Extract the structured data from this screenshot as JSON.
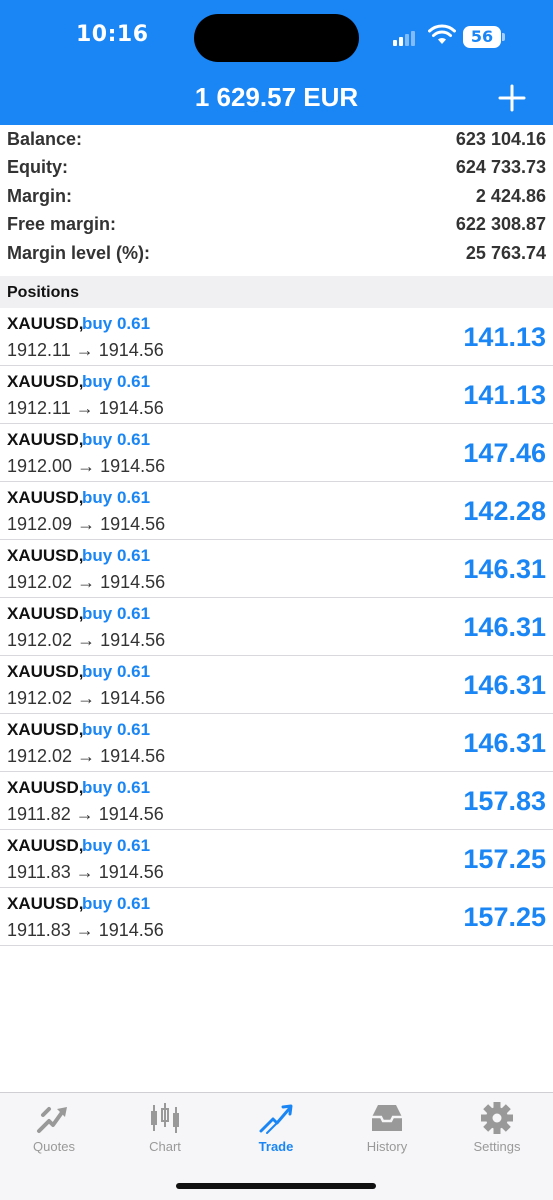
{
  "status_bar": {
    "time": "10:16",
    "battery": "56"
  },
  "header": {
    "title": "1 629.57 EUR"
  },
  "account": [
    {
      "label": "Balance:",
      "value": "623 104.16"
    },
    {
      "label": "Equity:",
      "value": "624 733.73"
    },
    {
      "label": "Margin:",
      "value": "2 424.86"
    },
    {
      "label": "Free margin:",
      "value": "622 308.87"
    },
    {
      "label": "Margin level (%):",
      "value": "25 763.74"
    }
  ],
  "positions_title": "Positions",
  "positions": [
    {
      "symbol": "XAUUSD,",
      "type": "buy 0.61",
      "prices": "1912.11 → 1914.56",
      "profit": "141.13"
    },
    {
      "symbol": "XAUUSD,",
      "type": "buy 0.61",
      "prices": "1912.11 → 1914.56",
      "profit": "141.13"
    },
    {
      "symbol": "XAUUSD,",
      "type": "buy 0.61",
      "prices": "1912.00 → 1914.56",
      "profit": "147.46"
    },
    {
      "symbol": "XAUUSD,",
      "type": "buy 0.61",
      "prices": "1912.09 → 1914.56",
      "profit": "142.28"
    },
    {
      "symbol": "XAUUSD,",
      "type": "buy 0.61",
      "prices": "1912.02 → 1914.56",
      "profit": "146.31"
    },
    {
      "symbol": "XAUUSD,",
      "type": "buy 0.61",
      "prices": "1912.02 → 1914.56",
      "profit": "146.31"
    },
    {
      "symbol": "XAUUSD,",
      "type": "buy 0.61",
      "prices": "1912.02 → 1914.56",
      "profit": "146.31"
    },
    {
      "symbol": "XAUUSD,",
      "type": "buy 0.61",
      "prices": "1912.02 → 1914.56",
      "profit": "146.31"
    },
    {
      "symbol": "XAUUSD,",
      "type": "buy 0.61",
      "prices": "1911.82 → 1914.56",
      "profit": "157.83"
    },
    {
      "symbol": "XAUUSD,",
      "type": "buy 0.61",
      "prices": "1911.83 → 1914.56",
      "profit": "157.25"
    },
    {
      "symbol": "XAUUSD,",
      "type": "buy 0.61",
      "prices": "1911.83 → 1914.56",
      "profit": "157.25"
    }
  ],
  "tabs": [
    {
      "label": "Quotes",
      "icon": "quotes-icon"
    },
    {
      "label": "Chart",
      "icon": "chart-icon"
    },
    {
      "label": "Trade",
      "icon": "trade-icon",
      "active": true
    },
    {
      "label": "History",
      "icon": "history-icon"
    },
    {
      "label": "Settings",
      "icon": "gear-icon"
    }
  ],
  "colors": {
    "accent": "#1a86f5",
    "header_bg": "#1a86f5",
    "tab_inactive": "#999999"
  }
}
